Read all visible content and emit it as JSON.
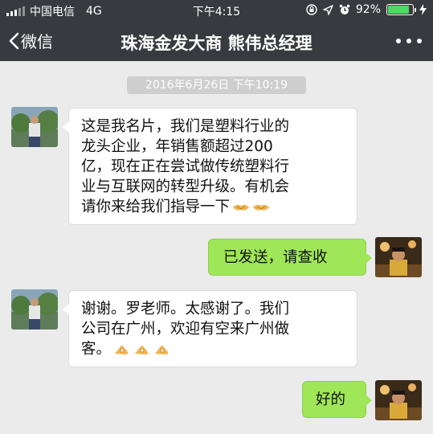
{
  "status_bar": {
    "carrier": "中国电信",
    "network": "4G",
    "time": "下午4:15",
    "battery": "92%",
    "battery_level": 0.92,
    "icons": [
      "signal-icon",
      "orientation-lock-icon",
      "location-icon",
      "alarm-icon",
      "battery-icon",
      "charging-icon"
    ]
  },
  "nav": {
    "back_label": "微信",
    "title": "珠海金发大商 熊伟总经理",
    "icons": [
      "chevron-left-icon",
      "more-icon"
    ]
  },
  "chat": {
    "timestamp": "2016年6月26日 下午10:19",
    "messages": [
      {
        "side": "incoming",
        "lines": [
          "这是我名片，我们是塑料行业的",
          "龙头企业，年销售额超过200",
          "亿，现在正在尝试做传统塑料行",
          "业与互联网的转型升级。有机会",
          "请你来给我们指导一下"
        ],
        "emoji": [
          "handshake-emoji",
          "handshake-emoji"
        ]
      },
      {
        "side": "outgoing",
        "lines": [
          "已发送，请查收"
        ],
        "emoji": []
      },
      {
        "side": "incoming",
        "lines": [
          "谢谢。罗老师。太感谢了。我们",
          "公司在广州，欢迎有空来广州做",
          "客。"
        ],
        "emoji": [
          "ok-hand-emoji",
          "ok-hand-emoji",
          "ok-hand-emoji"
        ]
      },
      {
        "side": "outgoing",
        "lines": [
          "好的"
        ],
        "emoji": []
      }
    ]
  },
  "colors": {
    "nav_background": "#393a3f",
    "chat_background": "#ebebeb",
    "outgoing_bubble": "#9fe658",
    "incoming_bubble": "#ffffff",
    "battery_fill": "#4cd964"
  }
}
